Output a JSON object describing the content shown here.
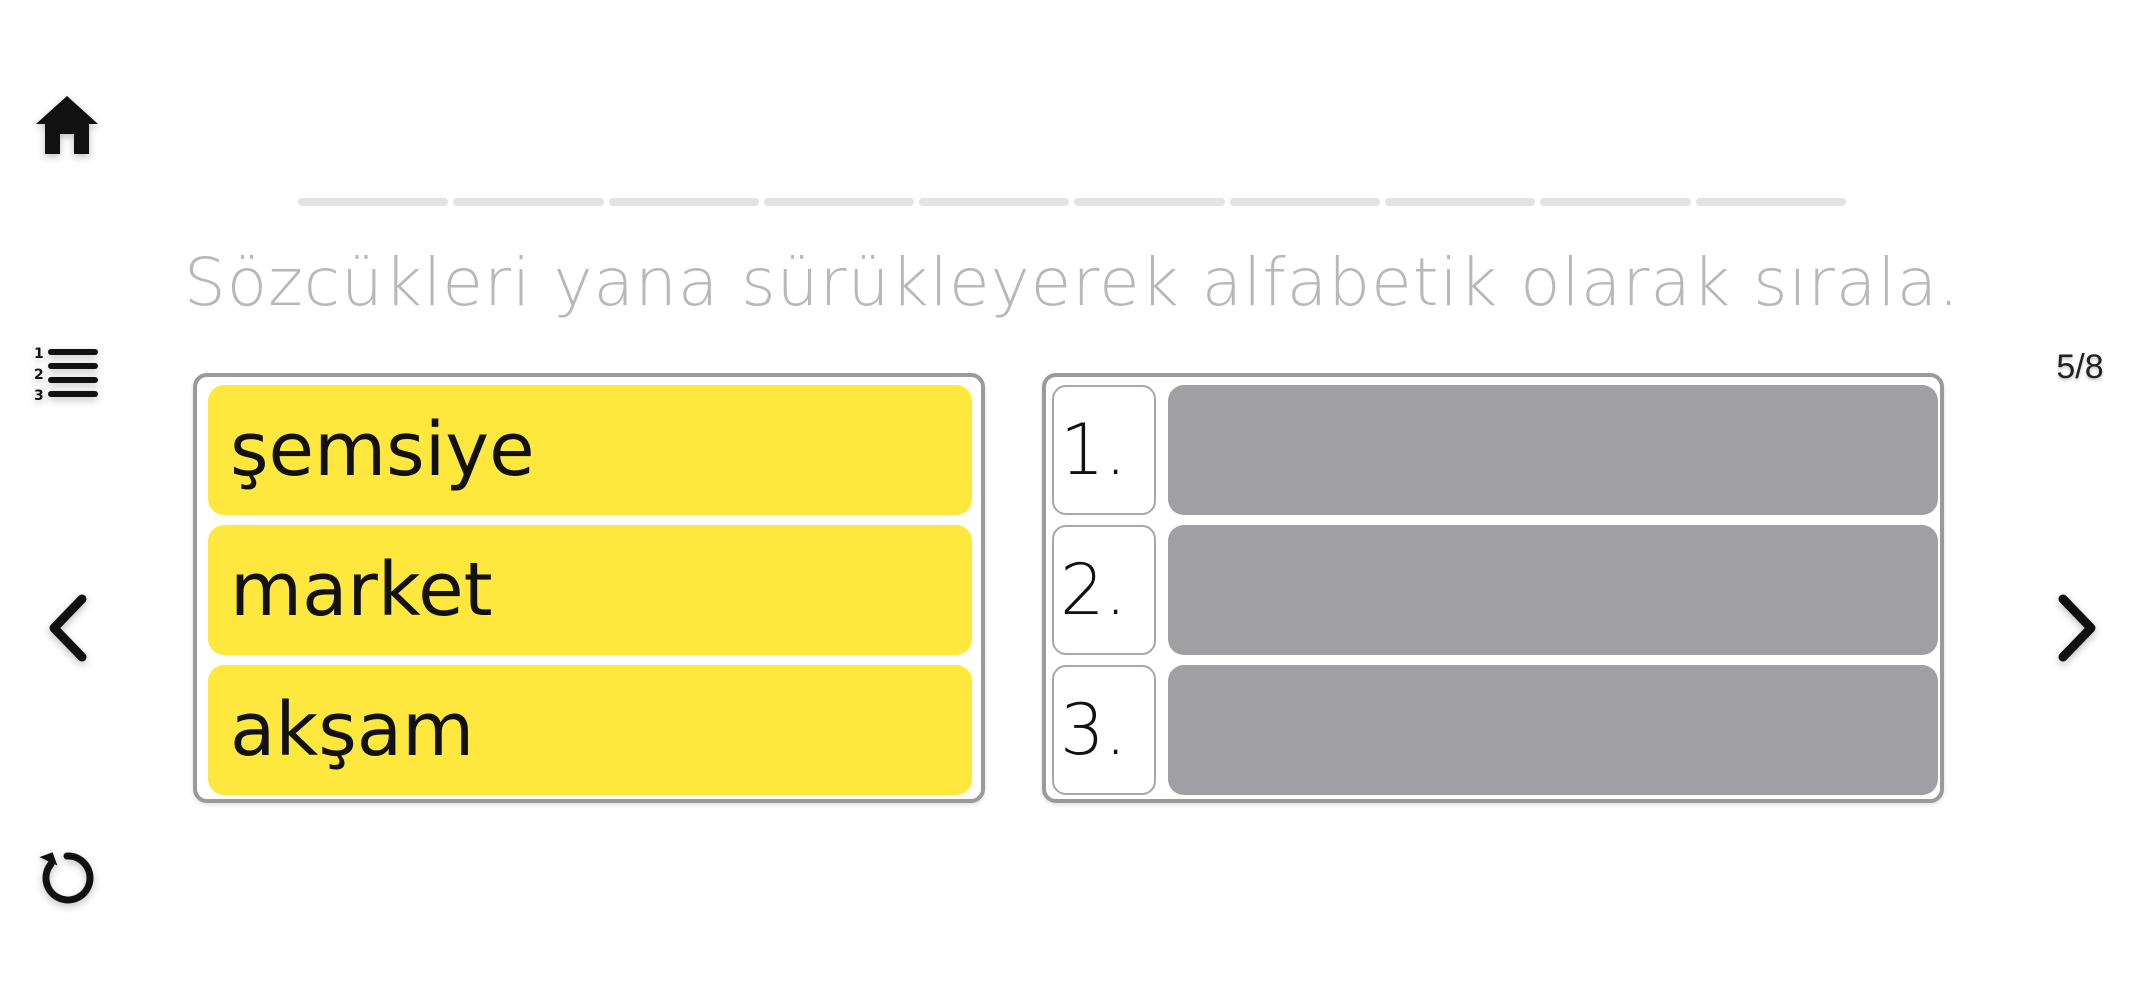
{
  "nav": {
    "home_icon": "home-icon",
    "list_icon": "numbered-list-icon",
    "prev_icon": "chevron-left-icon",
    "next_icon": "chevron-right-icon",
    "reset_icon": "reset-icon"
  },
  "page_counter": "5/8",
  "progress": {
    "segments": 10,
    "completed": 0
  },
  "instruction": "Sözcükleri yana sürükleyerek alfabetik olarak sırala.",
  "words": [
    "şemsiye",
    "market",
    "akşam"
  ],
  "slots": [
    "1.",
    "2.",
    "3."
  ],
  "colors": {
    "word_card": "#ffe83d",
    "drop_slot": "#a09fa3",
    "instruction": "#b8b8b8",
    "progress_segment": "#e3e3e3"
  }
}
